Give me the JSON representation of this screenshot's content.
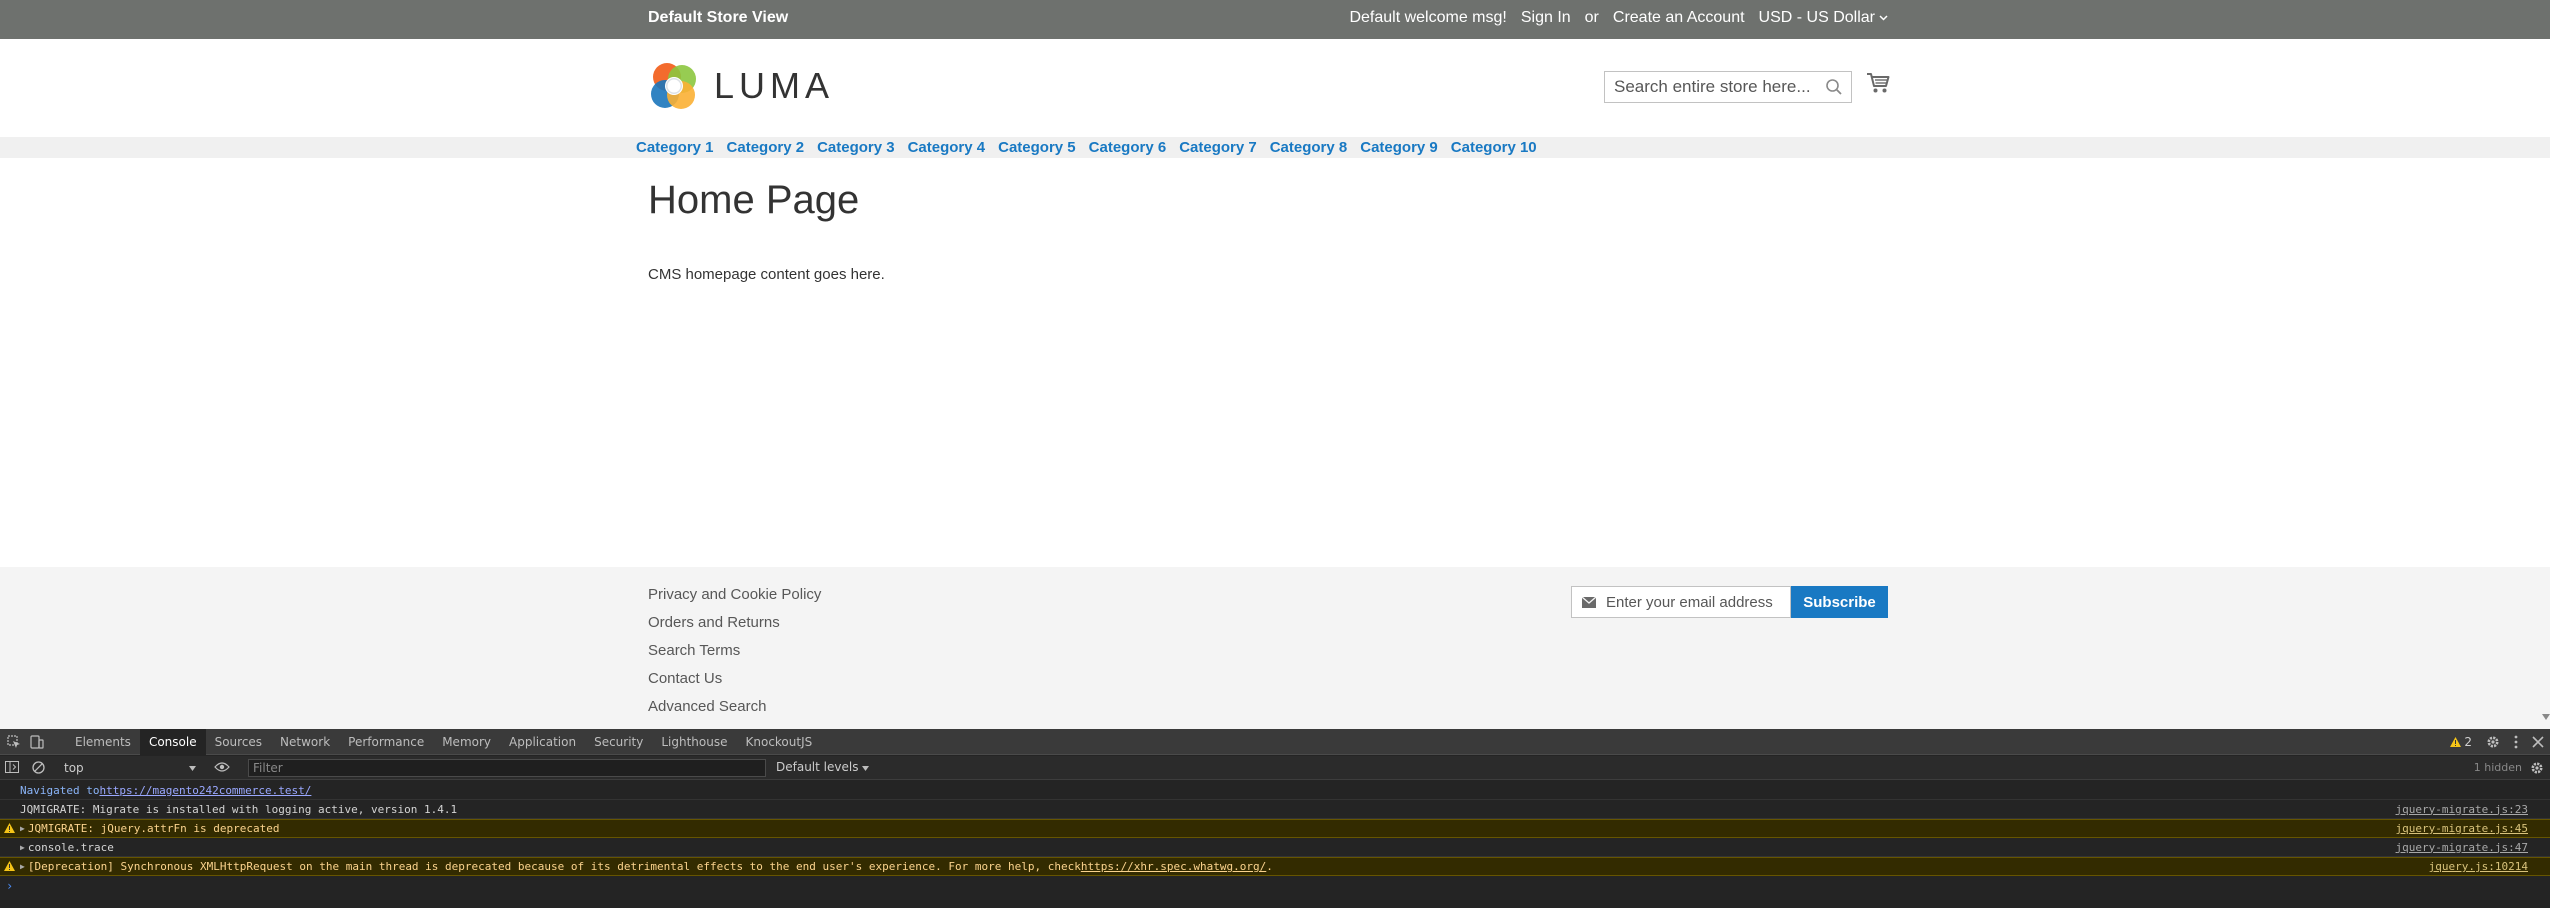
{
  "header": {
    "store_view": "Default Store View",
    "welcome": "Default welcome msg!",
    "sign_in": "Sign In",
    "or": "or",
    "create_account": "Create an Account",
    "currency": "USD - US Dollar"
  },
  "logo": {
    "text": "LUMA"
  },
  "search": {
    "placeholder": "Search entire store here..."
  },
  "nav": {
    "items": [
      "Category 1",
      "Category 2",
      "Category 3",
      "Category 4",
      "Category 5",
      "Category 6",
      "Category 7",
      "Category 8",
      "Category 9",
      "Category 10"
    ]
  },
  "page": {
    "title": "Home Page",
    "content": "CMS homepage content goes here."
  },
  "footer": {
    "links": [
      "Privacy and Cookie Policy",
      "Orders and Returns",
      "Search Terms",
      "Contact Us",
      "Advanced Search"
    ],
    "newsletter_placeholder": "Enter your email address",
    "subscribe_label": "Subscribe"
  },
  "devtools": {
    "tabs": [
      "Elements",
      "Console",
      "Sources",
      "Network",
      "Performance",
      "Memory",
      "Application",
      "Security",
      "Lighthouse",
      "KnockoutJS"
    ],
    "active_tab": "Console",
    "warning_count": "2",
    "context": "top",
    "filter_placeholder": "Filter",
    "levels": "Default levels",
    "hidden": "1 hidden",
    "messages": {
      "nav_prefix": "Navigated to ",
      "nav_url": "https://magento242commerce.test/",
      "migrate": "JQMIGRATE: Migrate is installed with logging active, version 1.4.1",
      "migrate_src": "jquery-migrate.js:23",
      "attrfn": "JQMIGRATE: jQuery.attrFn is deprecated",
      "attrfn_src": "jquery-migrate.js:45",
      "trace": "console.trace",
      "trace_src": "jquery-migrate.js:47",
      "deprecation": "[Deprecation] Synchronous XMLHttpRequest on the main thread is deprecated because of its detrimental effects to the end user's experience. For more help, check ",
      "deprecation_link": "https://xhr.spec.whatwg.org/",
      "deprecation_end": ".",
      "deprecation_src": "jquery.js:10214"
    },
    "prompt": "›"
  },
  "colors": {
    "header_bg": "#6e716e",
    "link_blue": "#1979c3",
    "nav_bg": "#f0f0f0",
    "footer_bg": "#f4f4f4",
    "devtools_bg": "#242424",
    "warning_bg": "#332b00",
    "warning_text": "#fbd38d"
  }
}
